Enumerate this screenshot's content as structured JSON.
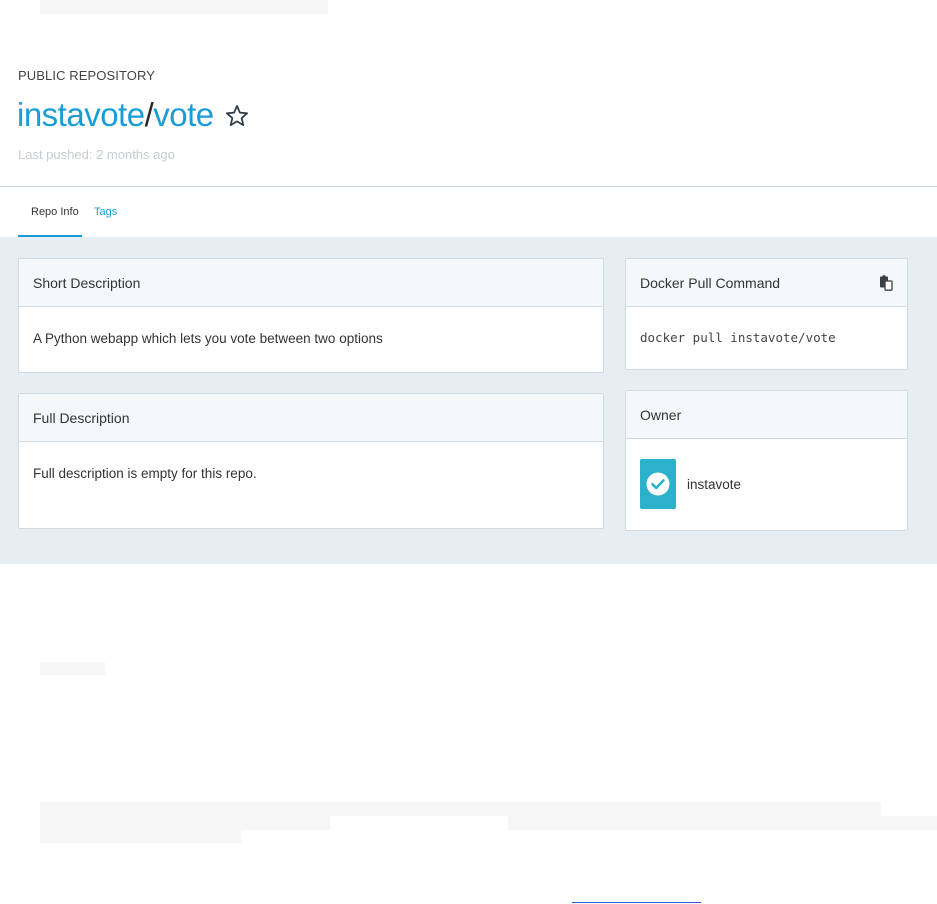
{
  "repo": {
    "kind": "PUBLIC REPOSITORY",
    "namespace": "instavote",
    "separator": "/",
    "name": "vote",
    "last_pushed": "Last pushed: 2 months ago"
  },
  "tabs": [
    {
      "label": "Repo Info",
      "active": true
    },
    {
      "label": "Tags",
      "active": false
    }
  ],
  "short_description": {
    "heading": "Short Description",
    "text": "A Python webapp which lets you vote between two options"
  },
  "full_description": {
    "heading": "Full Description",
    "text": "Full description is empty for this repo."
  },
  "pull_command": {
    "heading": "Docker Pull Command",
    "command": "docker pull instavote/vote"
  },
  "owner": {
    "heading": "Owner",
    "name": "instavote"
  },
  "colors": {
    "accent": "#1a9dd6",
    "content_bg": "#e6edf3",
    "avatar": "#2bb1c9"
  },
  "icons": {
    "star": "star-outline-icon",
    "copy": "clipboard-icon",
    "owner_avatar": "check-circle-icon"
  }
}
